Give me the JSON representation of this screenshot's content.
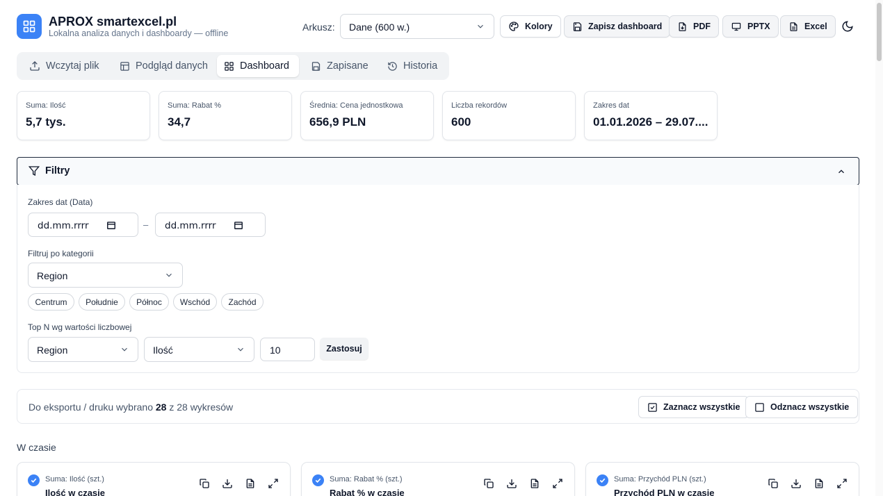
{
  "brand": {
    "title": "APROX smartexcel.pl",
    "subtitle": "Lokalna analiza danych i dashboardy — offline"
  },
  "header": {
    "sheet_label": "Arkusz:",
    "sheet_value": "Dane (600 w.)",
    "buttons": {
      "colors": "Kolory",
      "save": "Zapisz dashboard",
      "pdf": "PDF",
      "pptx": "PPTX",
      "excel": "Excel"
    }
  },
  "tabs": [
    {
      "label": "Wczytaj plik",
      "icon": "upload-icon"
    },
    {
      "label": "Podgląd danych",
      "icon": "table-icon"
    },
    {
      "label": "Dashboard",
      "icon": "dashboard-icon",
      "active": true
    },
    {
      "label": "Zapisane",
      "icon": "save-icon"
    },
    {
      "label": "Historia",
      "icon": "history-icon"
    }
  ],
  "kpis": [
    {
      "label": "Suma: Ilość",
      "value": "5,7 tys."
    },
    {
      "label": "Suma: Rabat %",
      "value": "34,7"
    },
    {
      "label": "Średnia: Cena jednostkowa",
      "value": "656,9 PLN"
    },
    {
      "label": "Liczba rekordów",
      "value": "600"
    },
    {
      "label": "Zakres dat",
      "value": "01.01.2026 – 29.07...."
    }
  ],
  "filters": {
    "title": "Filtry",
    "date_label": "Zakres dat (Data)",
    "date_from": "dd.mm.rrrr",
    "date_to": "dd.mm.rrrr",
    "date_sep": "–",
    "category_label": "Filtruj po kategorii",
    "category_value": "Region",
    "chips": [
      "Centrum",
      "Południe",
      "Północ",
      "Wschód",
      "Zachód"
    ],
    "topn_label": "Top N wg wartości liczbowej",
    "topn_group": "Region",
    "topn_metric": "Ilość",
    "topn_count": "10",
    "apply": "Zastosuj"
  },
  "export": {
    "text_prefix": "Do eksportu / druku wybrano",
    "selected": "28",
    "text_suffix": "z 28 wykresów",
    "select_all": "Zaznacz wszystkie",
    "deselect_all": "Odznacz wszystkie"
  },
  "section_title": "W czasie",
  "cards": [
    {
      "sub": "Suma: Ilość (szt.)",
      "title": "Ilość w czasie"
    },
    {
      "sub": "Suma: Rabat % (szt.)",
      "title": "Rabat % w czasie"
    },
    {
      "sub": "Suma: Przychód PLN (szt.)",
      "title": "Przychód PLN w czasie"
    }
  ],
  "colors": {
    "accent": "#3b82f6",
    "text": "#0f172a",
    "muted": "#64748b"
  }
}
